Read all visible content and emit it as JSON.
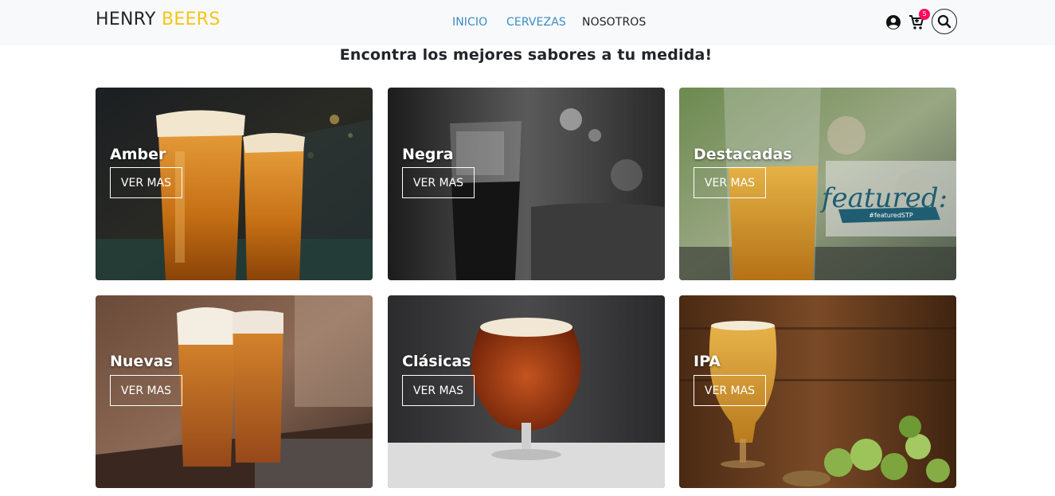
{
  "navbar": {
    "brand_part1": "HENRY",
    "brand_part2": "BEERS",
    "links": [
      {
        "label": "INICIO",
        "color": "#3a8ac4"
      },
      {
        "label": "CERVEZAS",
        "color": "#3a8ac4"
      },
      {
        "label": "NOSOTROS",
        "color": "#212529"
      }
    ],
    "icons": [
      "user-circle-icon",
      "cart-icon",
      "search-icon"
    ],
    "cart_count": "5",
    "accent_color": "#f5c518",
    "badge_color": "#ff0b5b"
  },
  "main": {
    "subtitle": "Encontra los mejores sabores a tu medida!",
    "cards": [
      {
        "title": "Amber",
        "button": "VER MAS"
      },
      {
        "title": "Negra",
        "button": "VER MAS"
      },
      {
        "title": "Destacadas",
        "button": "VER MAS",
        "overlay_text": "featured:",
        "overlay_tag": "#featuredSTP"
      },
      {
        "title": "Nuevas",
        "button": "VER MAS"
      },
      {
        "title": "Clásicas",
        "button": "VER MAS"
      },
      {
        "title": "IPA",
        "button": "VER MAS"
      }
    ]
  }
}
